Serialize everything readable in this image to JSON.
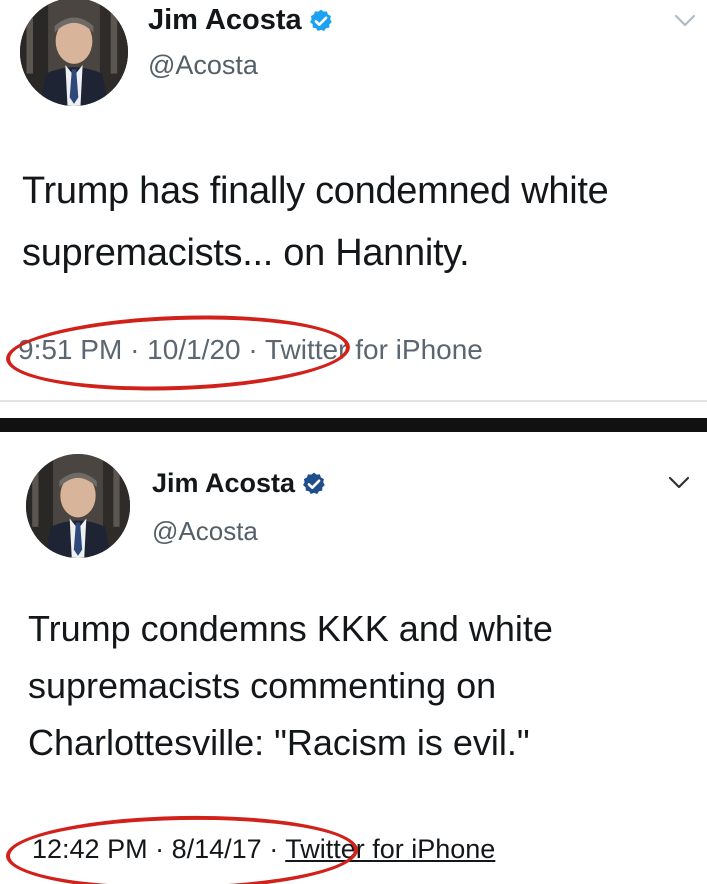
{
  "tweets": [
    {
      "author_name": "Jim Acosta",
      "handle": "@Acosta",
      "text": "Trump has finally condemned white supremacists... on Hannity.",
      "time": "9:51 PM",
      "date": "10/1/20",
      "source": "Twitter for iPhone",
      "verified_icon": "verified-badge-icon",
      "menu_icon": "chevron-down-icon"
    },
    {
      "author_name": "Jim Acosta",
      "handle": "@Acosta",
      "text": "Trump condemns KKK and white supremacists commenting on Charlottesville: \"Racism is evil.\"",
      "time": "12:42 PM",
      "date": "8/14/17",
      "source": "Twitter for iPhone",
      "verified_icon": "verified-badge-icon",
      "menu_icon": "chevron-down-icon"
    }
  ],
  "meta_separator": "·",
  "colors": {
    "verified_blue": "#1da1f2",
    "annotation_red": "#d0211b",
    "divider_black": "#111111"
  }
}
